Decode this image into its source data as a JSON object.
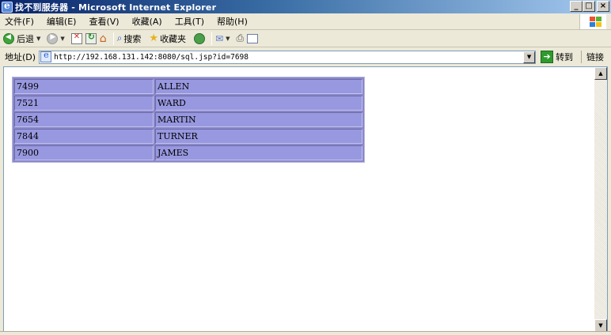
{
  "window": {
    "title": "找不到服务器 - Microsoft Internet Explorer",
    "buttons": {
      "minimize": "_",
      "maximize": "□",
      "close": "×"
    }
  },
  "menu": [
    "文件(F)",
    "编辑(E)",
    "查看(V)",
    "收藏(A)",
    "工具(T)",
    "帮助(H)"
  ],
  "toolbar": {
    "back": "后退",
    "search": "搜索",
    "favorites": "收藏夹"
  },
  "addressbar": {
    "label": "地址(D)",
    "url": "http://192.168.131.142:8080/sql.jsp?id=7698",
    "go": "转到",
    "links": "链接"
  },
  "table": {
    "rows": [
      [
        "7499",
        "ALLEN"
      ],
      [
        "7521",
        "WARD"
      ],
      [
        "7654",
        "MARTIN"
      ],
      [
        "7844",
        "TURNER"
      ],
      [
        "7900",
        "JAMES"
      ]
    ]
  },
  "colors": {
    "cell_bg": "#9898e0",
    "title_gradient_start": "#0a246a"
  }
}
